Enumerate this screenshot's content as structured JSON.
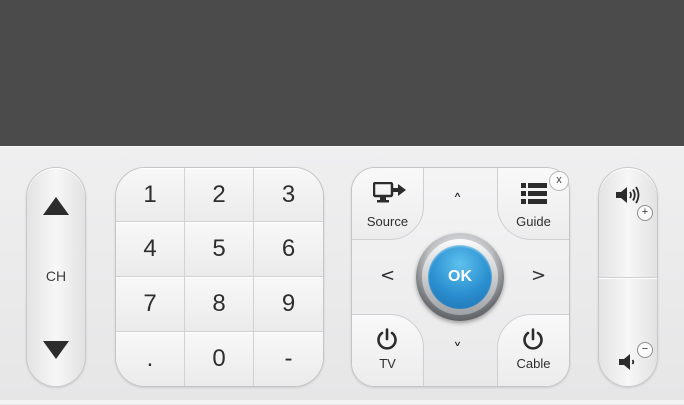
{
  "channel": {
    "label": "CH"
  },
  "keypad": {
    "keys": [
      "1",
      "2",
      "3",
      "4",
      "5",
      "6",
      "7",
      "8",
      "9",
      ".",
      "0",
      "-"
    ]
  },
  "nav": {
    "source_label": "Source",
    "guide_label": "Guide",
    "tv_label": "TV",
    "cable_label": "Cable",
    "ok_label": "OK",
    "up": "˄",
    "down": "˅",
    "left": "<",
    "right": ">",
    "close": "x"
  },
  "volume": {
    "plus": "+",
    "minus": "−"
  },
  "colors": {
    "top_background": "#4b4b4b",
    "ok_blue": "#2a8fd0",
    "panel": "#e9e9ea"
  },
  "icons": {
    "source": "source-input-icon",
    "guide": "list-guide-icon",
    "power": "power-icon",
    "volume_up": "speaker-loud-icon",
    "volume_down": "speaker-quiet-icon"
  }
}
